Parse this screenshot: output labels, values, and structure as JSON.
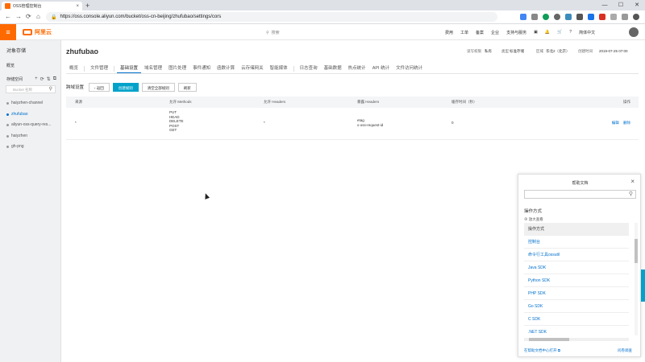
{
  "browser": {
    "tab_title": "OSS管理控制台",
    "tab_close": "×",
    "new_tab": "+",
    "url": "https://oss.console.aliyun.com/bucket/oss-cn-beijing/zhufubao/settings/cors",
    "window_controls": [
      "—",
      "☐",
      "✕"
    ]
  },
  "header": {
    "menu_icon": "≡",
    "logo_text": "阿里云",
    "search_placeholder": "搜索",
    "nav": [
      "费用",
      "工单",
      "备案",
      "企业",
      "支持与服务"
    ],
    "lang": "简体中文"
  },
  "sidebar": {
    "title": "对象存储",
    "overview": "概览",
    "bucket_header": "存储空间",
    "bucket_icons": [
      "+",
      "⟳",
      "⇅",
      "⧉"
    ],
    "search_placeholder": "Bucket 名称",
    "buckets": [
      {
        "name": "haiyzhen-channel",
        "active": false
      },
      {
        "name": "zhufubao",
        "active": true
      },
      {
        "name": "aliyun-oss-query-res...",
        "active": false
      },
      {
        "name": "haiyzhen",
        "active": false
      },
      {
        "name": "gh-png",
        "active": false
      }
    ]
  },
  "main": {
    "bucket_name": "zhufubao",
    "meta": {
      "acl_label": "读写权限",
      "acl_value": "私有",
      "type_label": "类型",
      "type_value": "标准存储",
      "region_label": "区域",
      "region_value": "华北2（北京）",
      "created_label": "创建时间",
      "created_value": "2019-07-25 07:00"
    },
    "tabs": [
      {
        "label": "概览",
        "active": false
      },
      {
        "label": "文件管理",
        "active": false
      },
      {
        "label": "基础设置",
        "active": true
      },
      {
        "label": "域名管理",
        "active": false
      },
      {
        "label": "图片处理",
        "active": false
      },
      {
        "label": "事件通知",
        "active": false
      },
      {
        "label": "函数计算",
        "active": false
      },
      {
        "label": "云存储网关",
        "active": false
      },
      {
        "label": "智能媒体",
        "active": false
      },
      {
        "label": "日志查询",
        "active": false
      },
      {
        "label": "基础数据",
        "active": false
      },
      {
        "label": "热点统计",
        "active": false
      },
      {
        "label": "API 统计",
        "active": false
      },
      {
        "label": "文件访问统计",
        "active": false
      }
    ],
    "section_title": "跨域设置",
    "buttons": {
      "back": "返回",
      "create": "创建规则",
      "clear": "清空全部规则",
      "refresh": "刷新"
    },
    "table": {
      "headers": [
        "来源",
        "允许 Methods",
        "允许 Headers",
        "暴露 Headers",
        "缓存时间（秒）",
        "操作"
      ],
      "rows": [
        {
          "source": "*",
          "methods": [
            "PUT",
            "HEAD",
            "DELETE",
            "POST",
            "GET"
          ],
          "allow_headers": "*",
          "expose_headers": [
            "etag",
            "x-oss-request-id"
          ],
          "max_age": "0",
          "actions": [
            "编辑",
            "删除"
          ]
        }
      ]
    }
  },
  "help": {
    "title": "帮助文档",
    "close": "×",
    "section": "操作方式",
    "zoom": "⊕ 放大查看",
    "items": [
      "操作方式",
      "控制台",
      "命令行工具ossutil",
      "Java SDK",
      "Python SDK",
      "PHP SDK",
      "Go SDK",
      "C SDK",
      ".NET SDK"
    ],
    "footer_link": "在帮助文档中心打开 ⧉",
    "feedback": "问卷调查"
  }
}
